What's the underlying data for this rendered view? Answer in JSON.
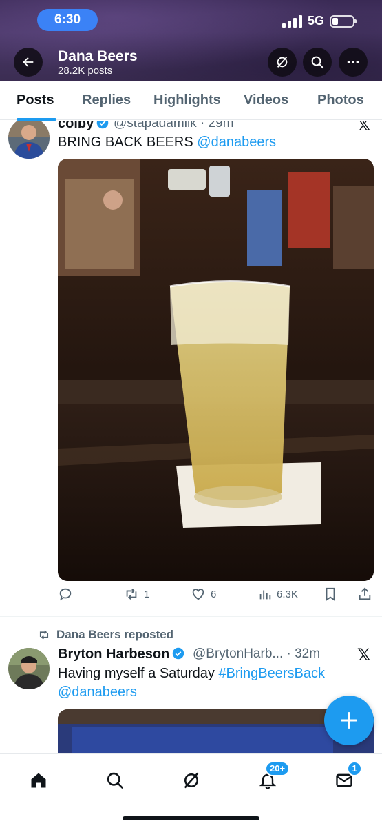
{
  "status_bar": {
    "time": "6:30",
    "network": "5G",
    "battery_level": 0.3
  },
  "header": {
    "title": "Dana Beers",
    "subtitle": "28.2K posts"
  },
  "tabs": [
    {
      "label": "Posts",
      "active": true
    },
    {
      "label": "Replies",
      "active": false
    },
    {
      "label": "Highlights",
      "active": false
    },
    {
      "label": "Videos",
      "active": false
    },
    {
      "label": "Photos",
      "active": false
    }
  ],
  "tweets": [
    {
      "name": "colby",
      "handle_time": "@stapadamilk · 29m",
      "text": "BRING BACK BEERS ",
      "mention": "@danabeers",
      "actions": {
        "replies": "",
        "reposts": "1",
        "likes": "6",
        "views": "6.3K"
      }
    },
    {
      "repost_label": "Dana Beers reposted",
      "name": "Bryton Harbeson",
      "handle_time": "@BrytonHarb... · 32m",
      "text": "Having myself a Saturday ",
      "hashtag": "#BringBeersBack",
      "mention": "@danabeers"
    }
  ],
  "bottom_nav": {
    "notifications_badge": "20+",
    "messages_badge": "1"
  },
  "colors": {
    "accent": "#1d9bf0",
    "header_bg": "#3b2d52"
  }
}
